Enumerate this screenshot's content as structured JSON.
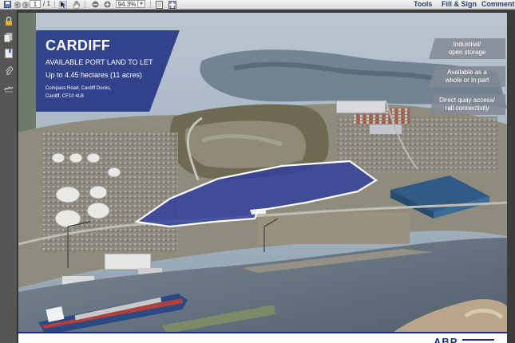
{
  "toolbar": {
    "page_current": "1",
    "page_total": "/ 1",
    "zoom": "94.3%",
    "links": {
      "tools": "Tools",
      "fill_sign": "Fill & Sign",
      "comment": "Comment"
    },
    "icons": [
      "save-icon",
      "back-icon",
      "forward-icon",
      "select-tool-icon",
      "hand-tool-icon",
      "zoom-out-icon",
      "zoom-in-icon",
      "fit-page-icon",
      "fullscreen-icon"
    ]
  },
  "left_pane": {
    "icons": [
      "lock-icon",
      "pages-icon",
      "bookmarks-icon",
      "attachments-icon",
      "signatures-icon"
    ]
  },
  "brochure": {
    "title": "CARDIFF",
    "subtitle": "AVAILABLE PORT LAND TO LET",
    "size": "Up to 4.45 hectares (11 acres)",
    "address_line1": "Compass Road, Cardiff Docks,",
    "address_line2": "Cardiff, CF10 4LB",
    "bullets": [
      {
        "line1": "Industrial/",
        "line2": "open storage"
      },
      {
        "line1": "Available as a",
        "line2": "whole or in part"
      },
      {
        "line1": "Direct quay access/",
        "line2": "rail connectivity"
      }
    ],
    "logo_text": "ABP",
    "colors": {
      "brand_navy": "#243484",
      "site_highlight": "#2f3f9e"
    }
  }
}
